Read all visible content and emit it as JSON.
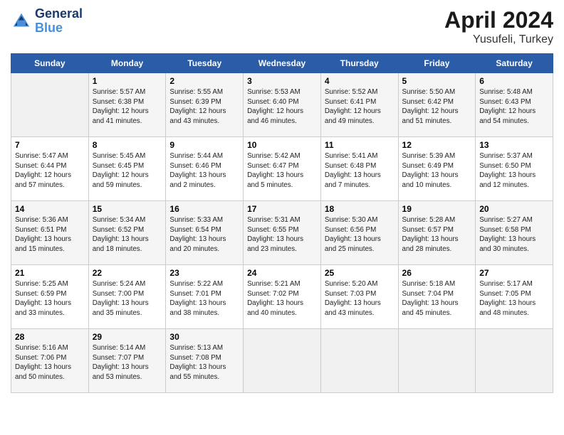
{
  "header": {
    "logo_line1": "General",
    "logo_line2": "Blue",
    "month_year": "April 2024",
    "location": "Yusufeli, Turkey"
  },
  "weekdays": [
    "Sunday",
    "Monday",
    "Tuesday",
    "Wednesday",
    "Thursday",
    "Friday",
    "Saturday"
  ],
  "weeks": [
    [
      {
        "day": "",
        "info": ""
      },
      {
        "day": "1",
        "info": "Sunrise: 5:57 AM\nSunset: 6:38 PM\nDaylight: 12 hours\nand 41 minutes."
      },
      {
        "day": "2",
        "info": "Sunrise: 5:55 AM\nSunset: 6:39 PM\nDaylight: 12 hours\nand 43 minutes."
      },
      {
        "day": "3",
        "info": "Sunrise: 5:53 AM\nSunset: 6:40 PM\nDaylight: 12 hours\nand 46 minutes."
      },
      {
        "day": "4",
        "info": "Sunrise: 5:52 AM\nSunset: 6:41 PM\nDaylight: 12 hours\nand 49 minutes."
      },
      {
        "day": "5",
        "info": "Sunrise: 5:50 AM\nSunset: 6:42 PM\nDaylight: 12 hours\nand 51 minutes."
      },
      {
        "day": "6",
        "info": "Sunrise: 5:48 AM\nSunset: 6:43 PM\nDaylight: 12 hours\nand 54 minutes."
      }
    ],
    [
      {
        "day": "7",
        "info": "Sunrise: 5:47 AM\nSunset: 6:44 PM\nDaylight: 12 hours\nand 57 minutes."
      },
      {
        "day": "8",
        "info": "Sunrise: 5:45 AM\nSunset: 6:45 PM\nDaylight: 12 hours\nand 59 minutes."
      },
      {
        "day": "9",
        "info": "Sunrise: 5:44 AM\nSunset: 6:46 PM\nDaylight: 13 hours\nand 2 minutes."
      },
      {
        "day": "10",
        "info": "Sunrise: 5:42 AM\nSunset: 6:47 PM\nDaylight: 13 hours\nand 5 minutes."
      },
      {
        "day": "11",
        "info": "Sunrise: 5:41 AM\nSunset: 6:48 PM\nDaylight: 13 hours\nand 7 minutes."
      },
      {
        "day": "12",
        "info": "Sunrise: 5:39 AM\nSunset: 6:49 PM\nDaylight: 13 hours\nand 10 minutes."
      },
      {
        "day": "13",
        "info": "Sunrise: 5:37 AM\nSunset: 6:50 PM\nDaylight: 13 hours\nand 12 minutes."
      }
    ],
    [
      {
        "day": "14",
        "info": "Sunrise: 5:36 AM\nSunset: 6:51 PM\nDaylight: 13 hours\nand 15 minutes."
      },
      {
        "day": "15",
        "info": "Sunrise: 5:34 AM\nSunset: 6:52 PM\nDaylight: 13 hours\nand 18 minutes."
      },
      {
        "day": "16",
        "info": "Sunrise: 5:33 AM\nSunset: 6:54 PM\nDaylight: 13 hours\nand 20 minutes."
      },
      {
        "day": "17",
        "info": "Sunrise: 5:31 AM\nSunset: 6:55 PM\nDaylight: 13 hours\nand 23 minutes."
      },
      {
        "day": "18",
        "info": "Sunrise: 5:30 AM\nSunset: 6:56 PM\nDaylight: 13 hours\nand 25 minutes."
      },
      {
        "day": "19",
        "info": "Sunrise: 5:28 AM\nSunset: 6:57 PM\nDaylight: 13 hours\nand 28 minutes."
      },
      {
        "day": "20",
        "info": "Sunrise: 5:27 AM\nSunset: 6:58 PM\nDaylight: 13 hours\nand 30 minutes."
      }
    ],
    [
      {
        "day": "21",
        "info": "Sunrise: 5:25 AM\nSunset: 6:59 PM\nDaylight: 13 hours\nand 33 minutes."
      },
      {
        "day": "22",
        "info": "Sunrise: 5:24 AM\nSunset: 7:00 PM\nDaylight: 13 hours\nand 35 minutes."
      },
      {
        "day": "23",
        "info": "Sunrise: 5:22 AM\nSunset: 7:01 PM\nDaylight: 13 hours\nand 38 minutes."
      },
      {
        "day": "24",
        "info": "Sunrise: 5:21 AM\nSunset: 7:02 PM\nDaylight: 13 hours\nand 40 minutes."
      },
      {
        "day": "25",
        "info": "Sunrise: 5:20 AM\nSunset: 7:03 PM\nDaylight: 13 hours\nand 43 minutes."
      },
      {
        "day": "26",
        "info": "Sunrise: 5:18 AM\nSunset: 7:04 PM\nDaylight: 13 hours\nand 45 minutes."
      },
      {
        "day": "27",
        "info": "Sunrise: 5:17 AM\nSunset: 7:05 PM\nDaylight: 13 hours\nand 48 minutes."
      }
    ],
    [
      {
        "day": "28",
        "info": "Sunrise: 5:16 AM\nSunset: 7:06 PM\nDaylight: 13 hours\nand 50 minutes."
      },
      {
        "day": "29",
        "info": "Sunrise: 5:14 AM\nSunset: 7:07 PM\nDaylight: 13 hours\nand 53 minutes."
      },
      {
        "day": "30",
        "info": "Sunrise: 5:13 AM\nSunset: 7:08 PM\nDaylight: 13 hours\nand 55 minutes."
      },
      {
        "day": "",
        "info": ""
      },
      {
        "day": "",
        "info": ""
      },
      {
        "day": "",
        "info": ""
      },
      {
        "day": "",
        "info": ""
      }
    ]
  ]
}
